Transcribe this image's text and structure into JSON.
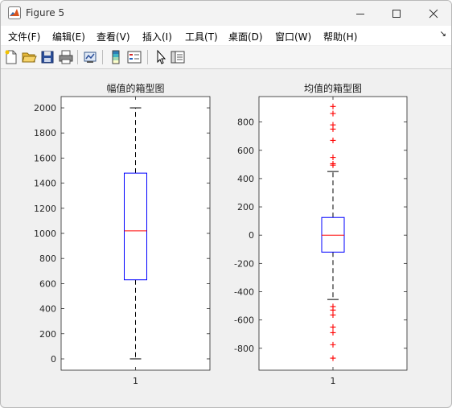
{
  "window": {
    "title": "Figure 5"
  },
  "menu": [
    "文件(F)",
    "编辑(E)",
    "查看(V)",
    "插入(I)",
    "工具(T)",
    "桌面(D)",
    "窗口(W)",
    "帮助(H)"
  ],
  "toolbar": {
    "buttons": [
      "new-figure-icon",
      "open-file-icon",
      "save-icon",
      "print-icon",
      "link-plot-icon",
      "colorbar-icon",
      "legend-icon",
      "pointer-icon",
      "property-editor-icon"
    ]
  },
  "colors": {
    "box": "#0000ff",
    "median": "#ff0000",
    "outlier": "#ff0000",
    "whisker": "#000000"
  },
  "chart_data": [
    {
      "type": "box",
      "title": "幅值的箱型图",
      "categories": [
        "1"
      ],
      "ylim": [
        -90,
        2090
      ],
      "yticks": [
        0,
        200,
        400,
        600,
        800,
        1000,
        1200,
        1400,
        1600,
        1800,
        2000
      ],
      "stats": {
        "whisker_low": 0,
        "q1": 630,
        "median": 1020,
        "q3": 1480,
        "whisker_high": 2000
      },
      "outliers": []
    },
    {
      "type": "box",
      "title": "均值的箱型图",
      "categories": [
        "1"
      ],
      "ylim": [
        -955,
        980
      ],
      "yticks": [
        -800,
        -600,
        -400,
        -200,
        0,
        200,
        400,
        600,
        800
      ],
      "stats": {
        "whisker_low": -455,
        "q1": -120,
        "median": 0,
        "q3": 125,
        "whisker_high": 450
      },
      "outliers": [
        910,
        860,
        780,
        750,
        670,
        550,
        505,
        495,
        -505,
        -530,
        -565,
        -650,
        -690,
        -775,
        -870
      ]
    }
  ]
}
